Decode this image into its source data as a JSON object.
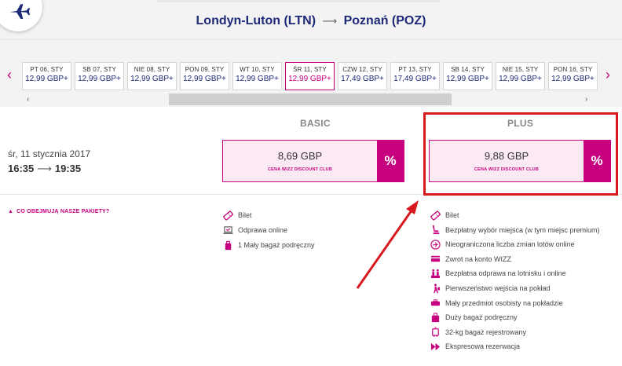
{
  "header": {
    "origin": "Londyn-Luton (LTN)",
    "arrow": "⟶",
    "destination": "Poznań (POZ)"
  },
  "datestrip": {
    "prev": "‹",
    "next": "›",
    "scroll_left": "‹",
    "scroll_right": "›",
    "dates": [
      {
        "day": "PT 06, STY",
        "price": "12,99 GBP+"
      },
      {
        "day": "SB 07, STY",
        "price": "12,99 GBP+"
      },
      {
        "day": "NIE 08, STY",
        "price": "12,99 GBP+"
      },
      {
        "day": "PON 09, STY",
        "price": "12,99 GBP+"
      },
      {
        "day": "WT 10, STY",
        "price": "12,99 GBP+"
      },
      {
        "day": "ŚR 11, STY",
        "price": "12,99 GBP+"
      },
      {
        "day": "CZW 12, STY",
        "price": "17,49 GBP+"
      },
      {
        "day": "PT 13, STY",
        "price": "17,49 GBP+"
      },
      {
        "day": "SB 14, STY",
        "price": "12,99 GBP+"
      },
      {
        "day": "NIE 15, STY",
        "price": "12,99 GBP+"
      },
      {
        "day": "PON 16, STY",
        "price": "12,99 GBP+"
      }
    ],
    "selected_index": 5
  },
  "flight": {
    "date": "śr, 11 stycznia 2017",
    "depart": "16:35",
    "arrow": "⟶",
    "arrive": "19:35"
  },
  "fares": {
    "basic": {
      "label": "BASIC",
      "amount": "8,69 GBP",
      "club": "CENA WIZZ DISCOUNT CLUB",
      "badge": "%"
    },
    "plus": {
      "label": "PLUS",
      "amount": "9,88 GBP",
      "club": "CENA WIZZ DISCOUNT CLUB",
      "badge": "%"
    }
  },
  "packages": {
    "toggle": "CO OBEJMUJĄ NASZE PAKIETY?",
    "toggle_icon": "▲",
    "basic_features": [
      {
        "icon": "ticket-icon",
        "label": "Bilet"
      },
      {
        "icon": "laptop-checkin-icon",
        "label": "Odprawa online"
      },
      {
        "icon": "small-bag-icon",
        "label": "1 Mały bagaż podręczny"
      }
    ],
    "plus_features": [
      {
        "icon": "ticket-icon",
        "label": "Bilet"
      },
      {
        "icon": "seat-icon",
        "label": "Bezpłatny wybór miejsca (w tym miejsc premium)"
      },
      {
        "icon": "flight-change-icon",
        "label": "Nieograniczona liczba zmian lotów online"
      },
      {
        "icon": "card-refund-icon",
        "label": "Zwrot na konto WIZZ"
      },
      {
        "icon": "airport-checkin-icon",
        "label": "Bezpłatna odprawa na lotnisku i online"
      },
      {
        "icon": "priority-boarding-icon",
        "label": "Pierwszeństwo wejścia na pokład"
      },
      {
        "icon": "personal-item-icon",
        "label": "Mały przedmiot osobisty na pokładzie"
      },
      {
        "icon": "cabin-bag-icon",
        "label": "Duży bagaż podręczny"
      },
      {
        "icon": "checked-bag-icon",
        "label": "32-kg bagaż rejestrowany"
      },
      {
        "icon": "express-booking-icon",
        "label": "Ekspresowa rezerwacja"
      }
    ]
  },
  "colors": {
    "brand_magenta": "#c6007e",
    "brand_navy": "#1e2a78",
    "annotation_red": "#d71920"
  }
}
